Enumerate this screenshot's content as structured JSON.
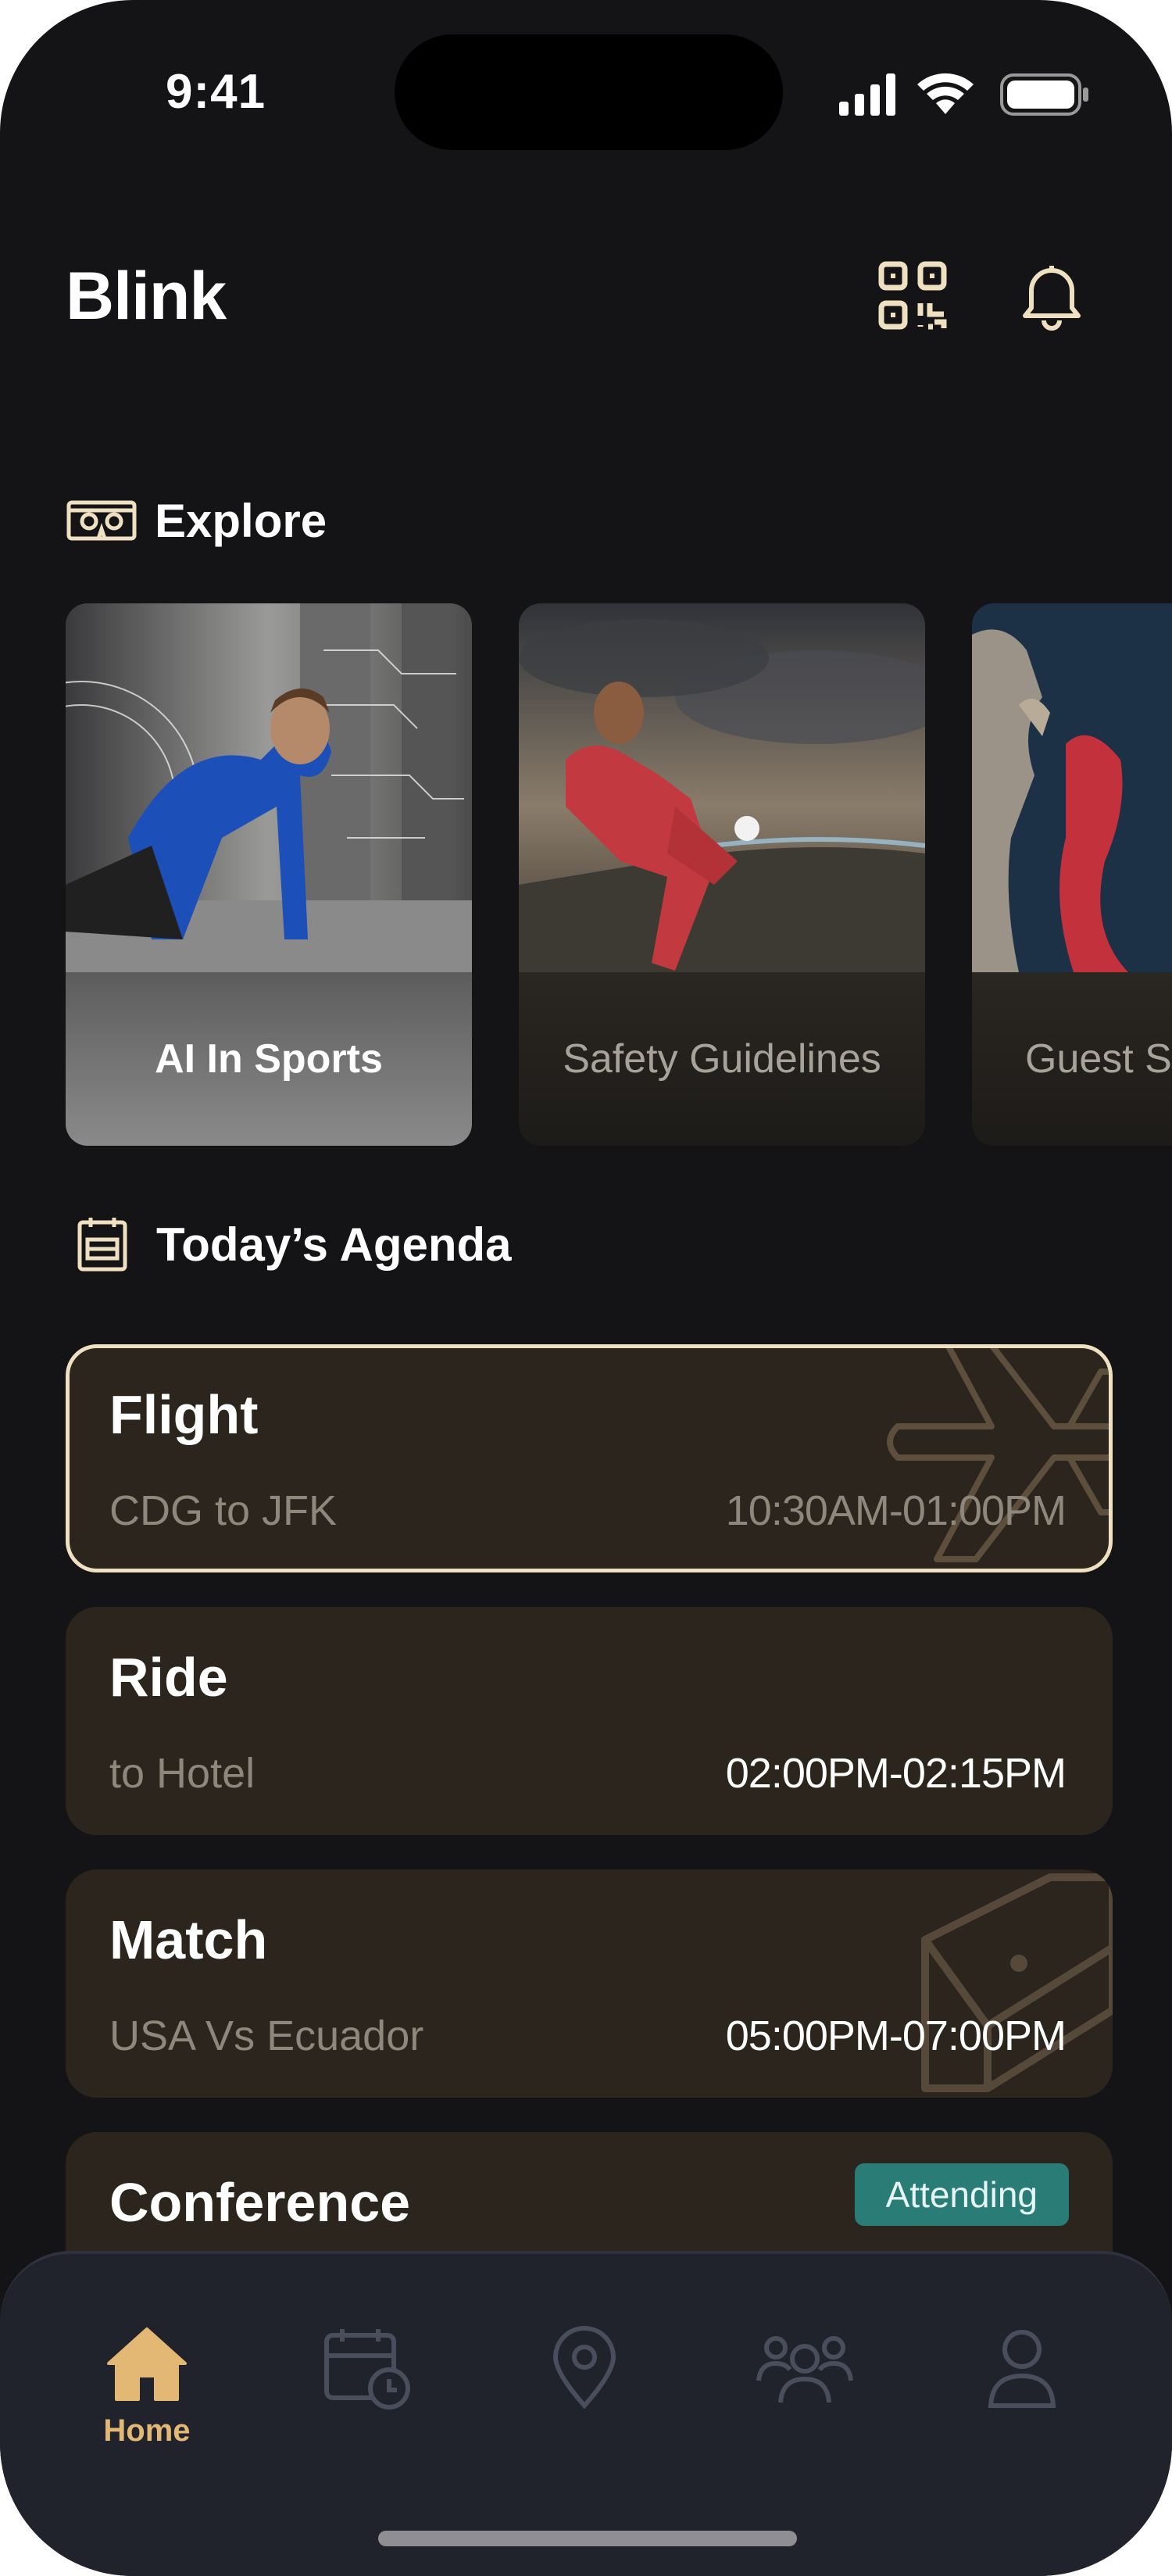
{
  "status_bar": {
    "time": "9:41"
  },
  "header": {
    "title": "Blink",
    "qr_icon": "qr-code-icon",
    "bell_icon": "bell-icon"
  },
  "explore": {
    "label": "Explore",
    "icon": "vr-headset-icon",
    "cards": [
      {
        "label": "AI In Sports"
      },
      {
        "label": "Safety Guidelines"
      },
      {
        "label": "Guest S"
      }
    ]
  },
  "agenda": {
    "label": "Today’s Agenda",
    "icon": "calendar-icon",
    "items": [
      {
        "title": "Flight",
        "subtitle": "CDG to JFK",
        "time": "10:30AM-01:00PM",
        "icon": "airplane-icon"
      },
      {
        "title": "Ride",
        "subtitle": "to Hotel",
        "time": "02:00PM-02:15PM"
      },
      {
        "title": "Match",
        "subtitle": "USA Vs Ecuador",
        "time": "05:00PM-07:00PM",
        "icon": "stadium-field-icon"
      },
      {
        "title": "Conference",
        "badge": "Attending"
      }
    ]
  },
  "tabbar": {
    "items": [
      {
        "label": "Home",
        "icon": "home-icon",
        "active": true
      },
      {
        "icon": "calendar-clock-icon"
      },
      {
        "icon": "map-pin-icon"
      },
      {
        "icon": "people-group-icon"
      },
      {
        "icon": "user-icon"
      }
    ],
    "accent": "#E3B874",
    "inactive": "#4A4D5C"
  },
  "colors": {
    "background": "#141416",
    "card": "#2B251E",
    "card_border_active": "#EFE0C2",
    "badge": "#2A7C77",
    "icon_tint": "#EFE0C2"
  }
}
